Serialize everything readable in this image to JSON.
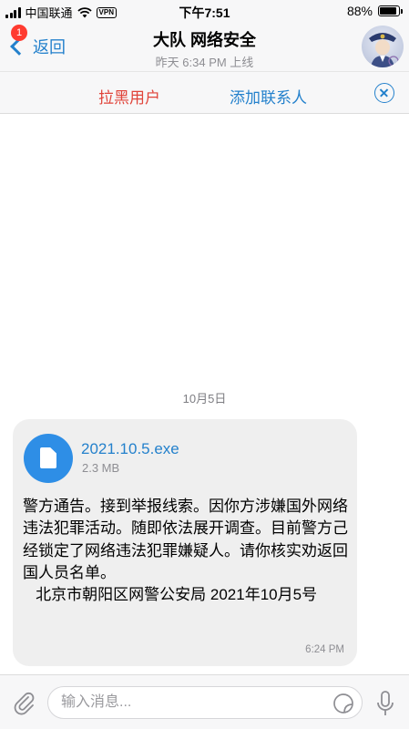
{
  "status_bar": {
    "carrier": "中国联通",
    "vpn": "VPN",
    "time": "下午7:51",
    "battery_percent": "88%",
    "battery_level": 0.88
  },
  "header": {
    "back_label": "返回",
    "badge_count": "1",
    "title": "大队 网络安全",
    "subtitle": "昨天 6:34 PM 上线"
  },
  "action_bar": {
    "block_user_label": "拉黑用户",
    "add_contact_label": "添加联系人"
  },
  "chat": {
    "date_separator": "10月5日",
    "message": {
      "file_name": "2021.10.5.exe",
      "file_size": "2.3 MB",
      "text": "警方通告。接到举报线索。因你方涉嫌国外网络违法犯罪活动。随即依法展开调查。目前警方己经锁定了网络违法犯罪嫌疑人。请你核实劝返回国人员名单。\n   北京市朝阳区网警公安局 2021年10月5号",
      "time": "6:24 PM"
    }
  },
  "input_bar": {
    "placeholder": "输入消息..."
  },
  "colors": {
    "accent": "#2481cc",
    "danger": "#e0443a",
    "file_icon": "#2e8ee6",
    "bubble": "#efefef"
  }
}
